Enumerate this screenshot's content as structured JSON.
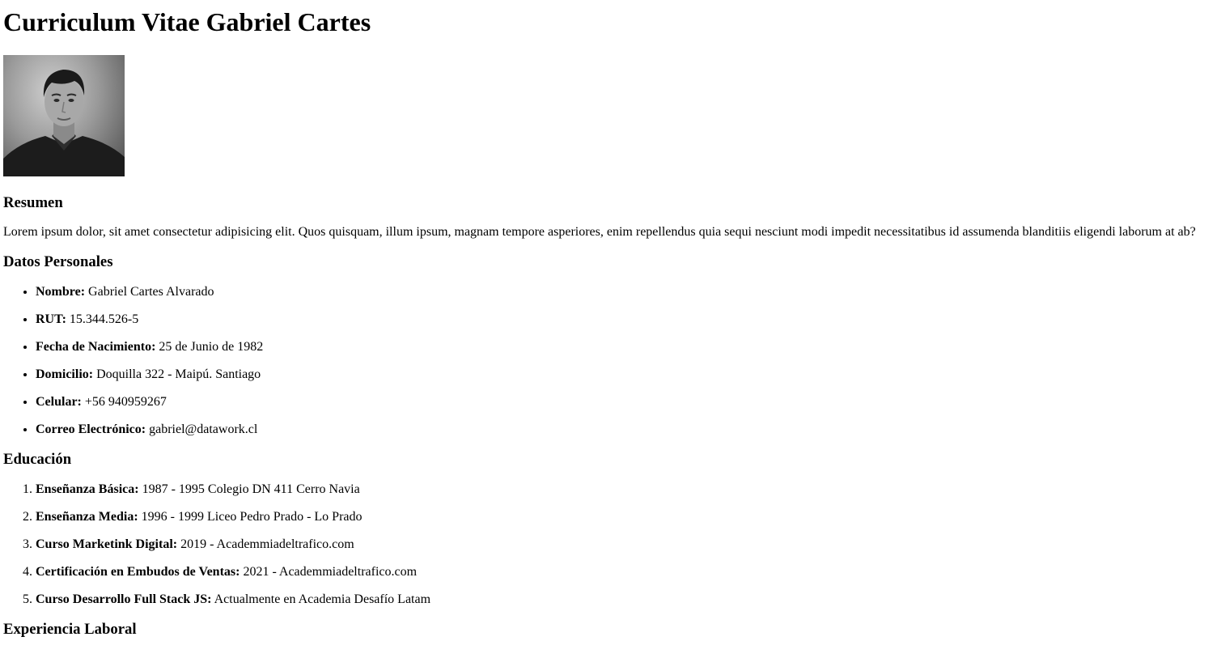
{
  "title": "Curriculum Vitae Gabriel Cartes",
  "photo": {
    "alt": "Foto de Gabriel Cartes"
  },
  "resumen": {
    "heading": "Resumen",
    "text": "Lorem ipsum dolor, sit amet consectetur adipisicing elit. Quos quisquam, illum ipsum, magnam tempore asperiores, enim repellendus quia sequi nesciunt modi impedit necessitatibus id assumenda blanditiis eligendi laborum at ab?"
  },
  "datos": {
    "heading": "Datos Personales",
    "items": [
      {
        "label": "Nombre:",
        "value": "Gabriel Cartes Alvarado"
      },
      {
        "label": "RUT:",
        "value": "15.344.526-5"
      },
      {
        "label": "Fecha de Nacimiento:",
        "value": "25 de Junio de 1982"
      },
      {
        "label": "Domicilio:",
        "value": "Doquilla 322 - Maipú. Santiago"
      },
      {
        "label": "Celular:",
        "value": "+56 940959267"
      },
      {
        "label": "Correo Electrónico:",
        "value": "gabriel@datawork.cl"
      }
    ]
  },
  "educacion": {
    "heading": "Educación",
    "items": [
      {
        "label": "Enseñanza Básica:",
        "value": "1987 - 1995 Colegio DN 411 Cerro Navia"
      },
      {
        "label": "Enseñanza Media:",
        "value": "1996 - 1999 Liceo Pedro Prado - Lo Prado"
      },
      {
        "label": "Curso Marketink Digital:",
        "value": "2019 - Academmiadeltrafico.com"
      },
      {
        "label": "Certificación en Embudos de Ventas:",
        "value": "2021 - Academmiadeltrafico.com"
      },
      {
        "label": "Curso Desarrollo Full Stack JS:",
        "value": "Actualmente en Academia Desafío Latam"
      }
    ]
  },
  "experiencia": {
    "heading": "Experiencia Laboral"
  }
}
